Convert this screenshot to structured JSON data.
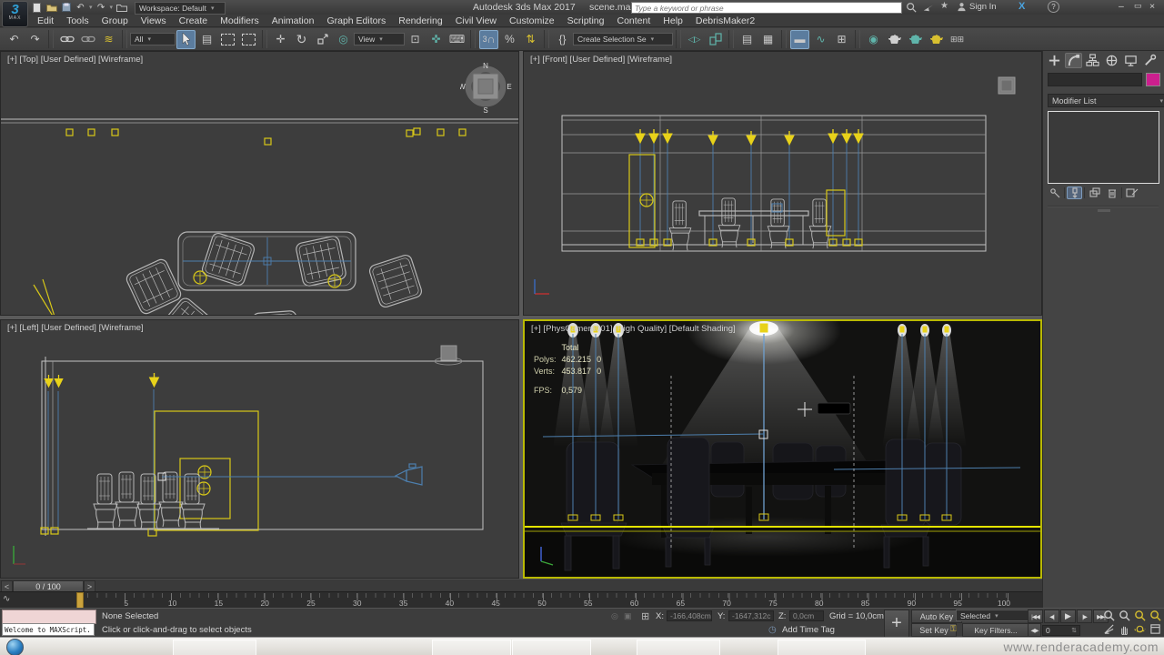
{
  "titlebar": {
    "workspace": "Workspace: Default",
    "app_title": "Autodesk 3ds Max 2017",
    "file_name": "scene.max",
    "search_placeholder": "Type a keyword or phrase",
    "sign_in": "Sign In"
  },
  "menus": [
    "Edit",
    "Tools",
    "Group",
    "Views",
    "Create",
    "Modifiers",
    "Animation",
    "Graph Editors",
    "Rendering",
    "Civil View",
    "Customize",
    "Scripting",
    "Content",
    "Help",
    "DebrisMaker2"
  ],
  "toolbar": {
    "filter": "All",
    "coord_system": "View",
    "selection_set": "Create Selection Se"
  },
  "viewports": {
    "top": {
      "label": "[+] [Top] [User Defined] [Wireframe]",
      "compass": {
        "n": "N",
        "e": "E",
        "s": "S",
        "w": "W"
      }
    },
    "front": {
      "label": "[+] [Front] [User Defined] [Wireframe]"
    },
    "left": {
      "label": "[+] [Left] [User Defined] [Wireframe]"
    },
    "camera": {
      "label": "[+] [PhysCamera001] [High Quality] [Default Shading]",
      "stats": {
        "total": "Total",
        "polys_label": "Polys:",
        "polys_value": "462.215",
        "polys_extra": "0",
        "verts_label": "Verts:",
        "verts_value": "453.817",
        "verts_extra": "0",
        "fps_label": "FPS:",
        "fps_value": "0,579"
      }
    }
  },
  "command_panel": {
    "modifier_list": "Modifier List"
  },
  "timeline": {
    "frame_display": "0 / 100",
    "ticks": [
      "0",
      "5",
      "10",
      "15",
      "20",
      "25",
      "30",
      "35",
      "40",
      "45",
      "50",
      "55",
      "60",
      "65",
      "70",
      "75",
      "80",
      "85",
      "90",
      "95",
      "100"
    ]
  },
  "status": {
    "maxscript": "Welcome to MAXScript.",
    "selection": "None Selected",
    "prompt": "Click or click-and-drag to select objects",
    "x_label": "X:",
    "x_value": "-166,408cm",
    "y_label": "Y:",
    "y_value": "-1647,312c",
    "z_label": "Z:",
    "z_value": "0,0cm",
    "grid": "Grid = 10,0cm",
    "add_time_tag": "Add Time Tag",
    "auto_key": "Auto Key",
    "set_key": "Set Key",
    "selected": "Selected",
    "key_filters": "Key Filters...",
    "frame": "0"
  },
  "taskbar": {
    "watermark": "www.renderacademy.com"
  },
  "colors": {
    "selection_yellow": "#d8c818",
    "wire_blue": "#4d7fae",
    "wire_white": "#b8b8b8",
    "active_border": "#b9b900",
    "swatch_magenta": "#cc1f8e"
  },
  "icons": {
    "undo": "↶",
    "redo": "↷",
    "bind_spacewarp": "≋",
    "select_by_name": "▤",
    "place": "◎",
    "pivot_center": "⊡",
    "manipulate": "✜",
    "keyboard_override": "⌨",
    "snap": "∩",
    "snap_mode": "3",
    "percent_snap": "%",
    "spinner_snap": "⇅",
    "named_sets": "{}",
    "mirror": "◁▷",
    "scene_explorer": "▤",
    "layer_explorer": "▦",
    "ribbon": "▬",
    "curve_editor": "∿",
    "schematic": "⊞",
    "material_editor": "◉",
    "container": "⊞⊞",
    "star": "★",
    "exchange": "X",
    "help": "?",
    "minimize": "–",
    "restore": "▭",
    "close": "×",
    "caret": "▾",
    "go_start": "|◀◀",
    "prev_frame": "◀|",
    "play": "▶",
    "next_frame": "|▶",
    "go_end": "▶▶|",
    "key_step": "◀▶",
    "spinner": "⇅",
    "time_tag": "◷",
    "isolate": "◎",
    "lock": "▣",
    "big_plus": "+",
    "move": "✛",
    "rotate": "↻",
    "coord_grid": "⊞",
    "mini_curve": "∿",
    "slider_prev": "<",
    "slider_next": ">"
  }
}
